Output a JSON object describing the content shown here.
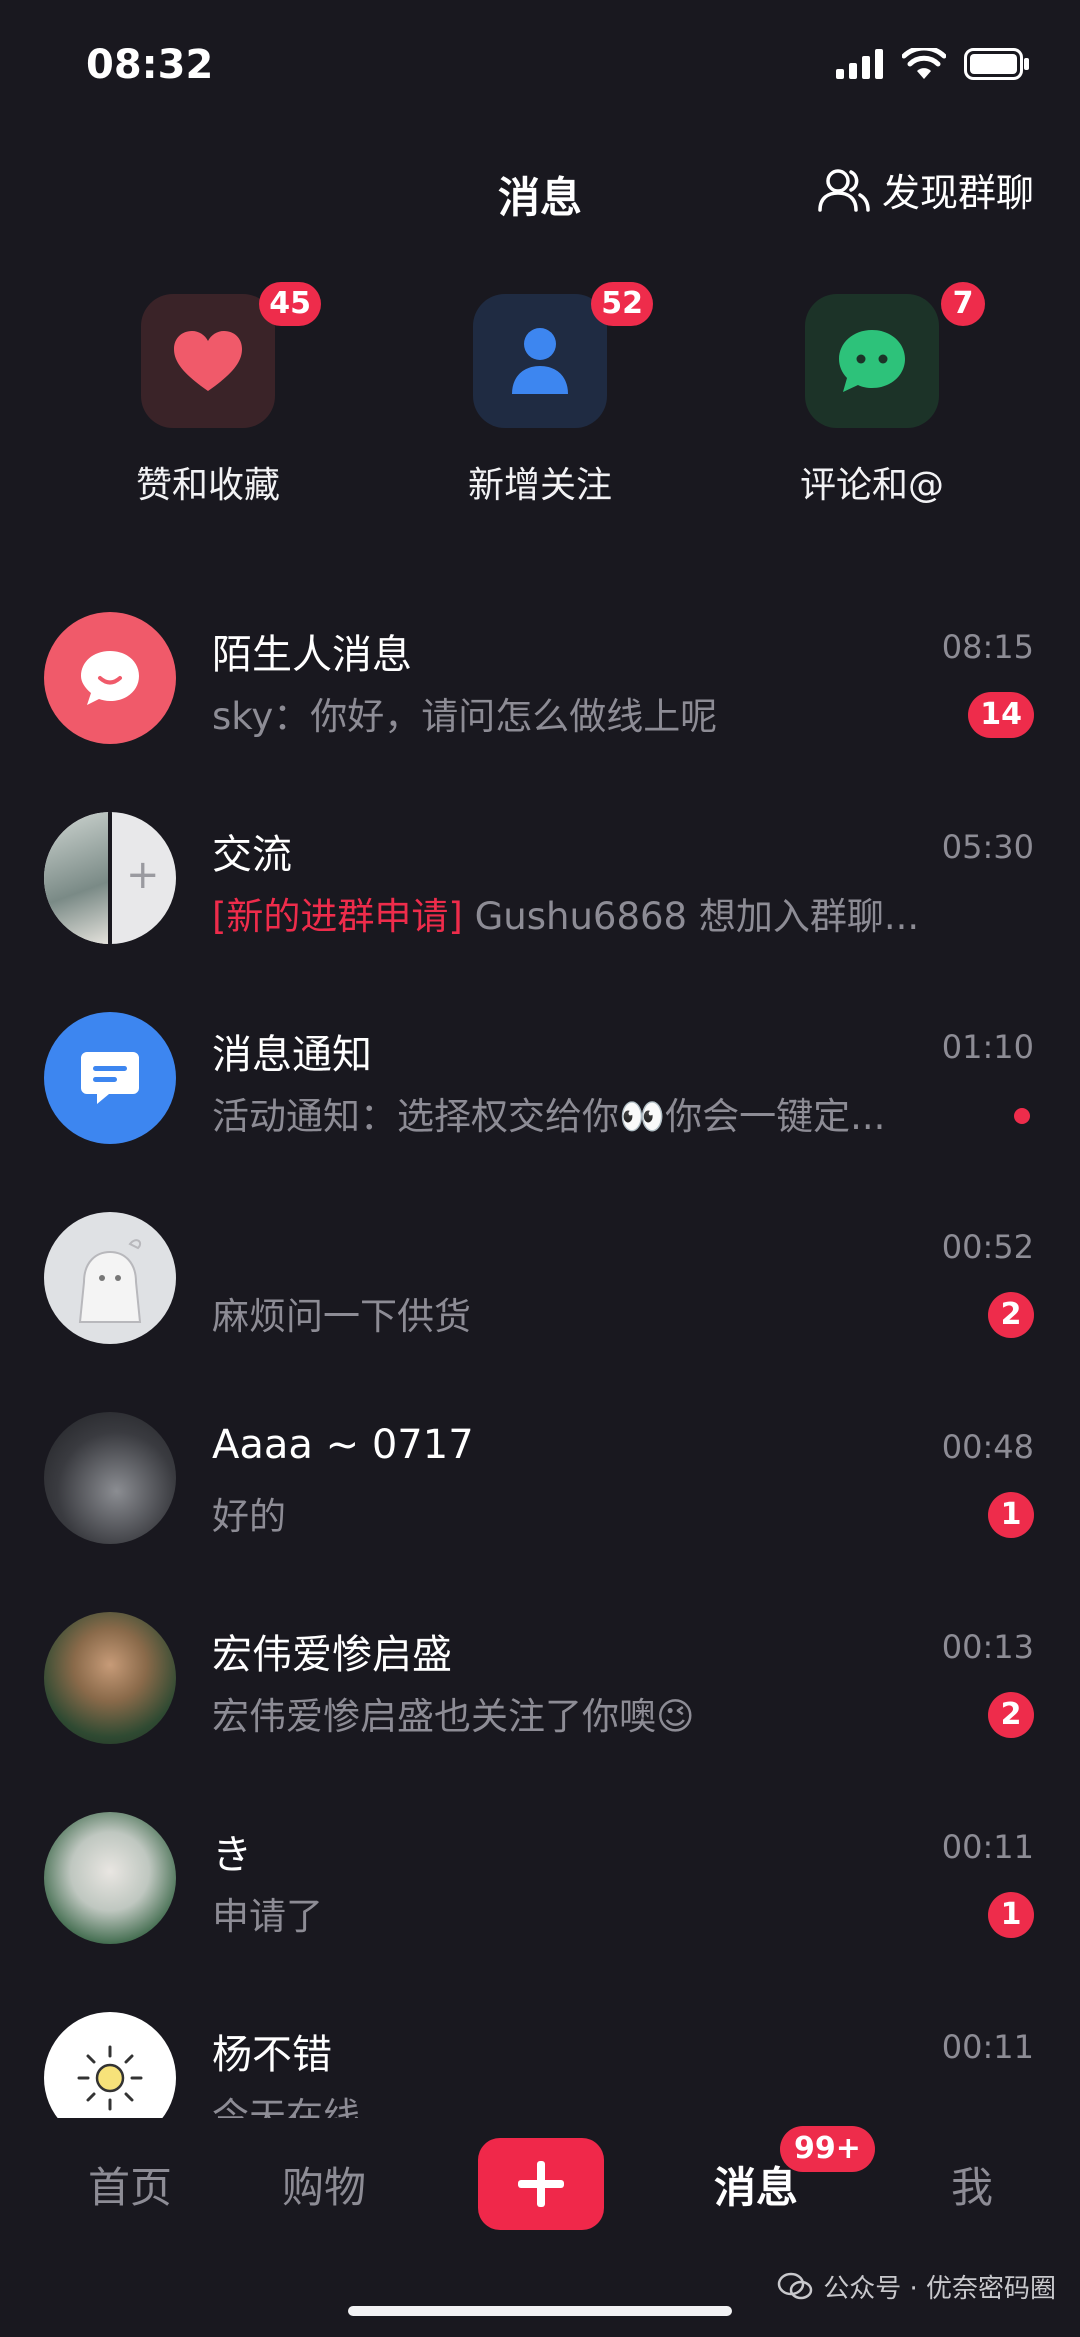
{
  "status_bar": {
    "time": "08:32"
  },
  "header": {
    "title": "消息",
    "discover_label": "发现群聊"
  },
  "quick": [
    {
      "label": "赞和收藏",
      "badge": "45",
      "color": "#f05a6a"
    },
    {
      "label": "新增关注",
      "badge": "52",
      "color": "#3d86f0"
    },
    {
      "label": "评论和@",
      "badge": "7",
      "color": "#2dc27a"
    }
  ],
  "messages": [
    {
      "name": "陌生人消息",
      "preview": "sky：你好，请问怎么做线上呢",
      "time": "08:15",
      "badge": "14"
    },
    {
      "name": "交流",
      "preview_tag": "[新的进群申请]",
      "preview": " Gushu6868 想加入群聊...",
      "time": "05:30"
    },
    {
      "name": "消息通知",
      "preview": "活动通知：选择权交给你👀你会一键定...",
      "time": "01:10"
    },
    {
      "name": "",
      "preview": "麻烦问一下供货",
      "time": "00:52",
      "badge": "2"
    },
    {
      "name": "Aaaa ~ 0717",
      "preview": "好的",
      "time": "00:48",
      "badge": "1"
    },
    {
      "name": "宏伟爱惨启盛",
      "preview": "宏伟爱惨启盛也关注了你噢😉",
      "time": "00:13",
      "badge": "2"
    },
    {
      "name": "き",
      "preview": "申请了",
      "time": "00:11",
      "badge": "1"
    },
    {
      "name": "杨不错",
      "preview": "今天在线",
      "time": "00:11"
    }
  ],
  "bottom_nav": {
    "home": "首页",
    "shop": "购物",
    "messages": "消息",
    "messages_badge": "99+",
    "me": "我"
  },
  "watermark": "公众号 · 优奈密码圈",
  "colors": {
    "accent": "#ee2c4b",
    "background": "#19181f"
  }
}
